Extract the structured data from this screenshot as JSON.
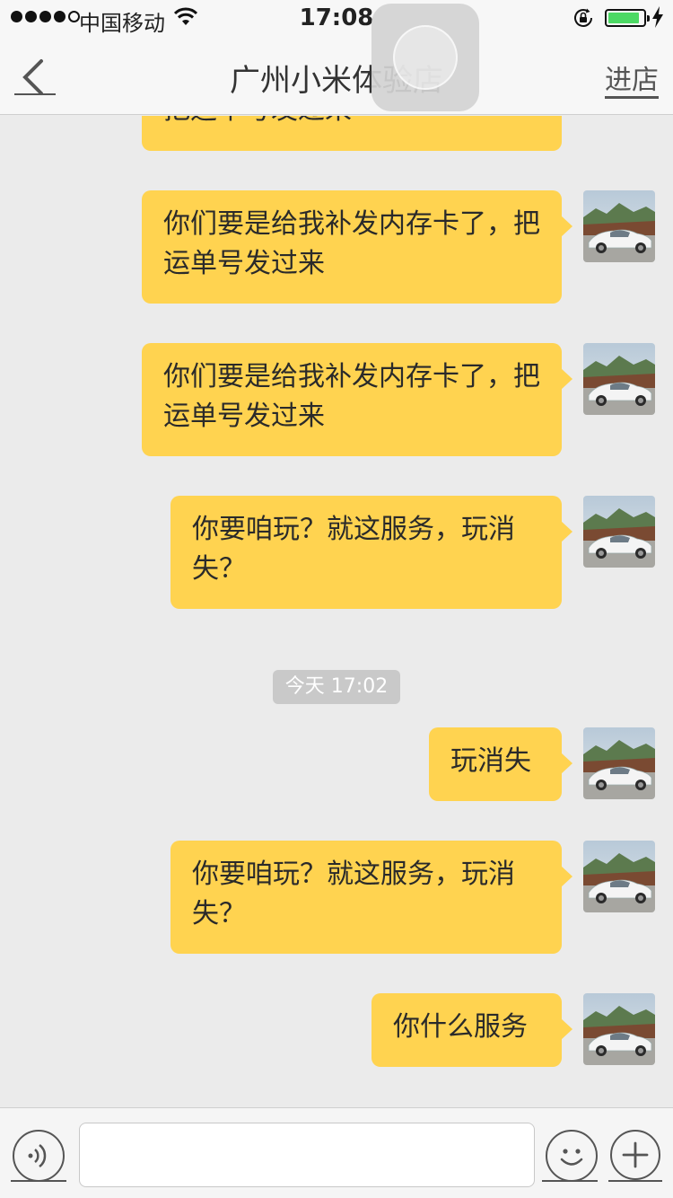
{
  "status_bar": {
    "carrier": "中国移动",
    "time": "17:08",
    "battery_level": 0.9,
    "battery_color": "#4cd964",
    "icons": [
      "signal-dots-icon",
      "wifi-icon",
      "rotation-lock-icon",
      "battery-icon",
      "charging-bolt-icon"
    ]
  },
  "nav": {
    "title": "广州小米体验店",
    "right_action": "进店",
    "back_icon": "chevron-left-icon"
  },
  "chat": {
    "bubble_color": "#ffd350",
    "messages": [
      {
        "from": "me",
        "text": "把运单号发过来"
      },
      {
        "from": "me",
        "text": "你们要是给我补发内存卡了，把运单号发过来"
      },
      {
        "from": "me",
        "text": "你们要是给我补发内存卡了，把运单号发过来"
      },
      {
        "from": "me",
        "text": "你要咱玩？就这服务，玩消失？"
      },
      {
        "from": "me",
        "text": "玩消失"
      },
      {
        "from": "me",
        "text": "你要咱玩？就这服务，玩消失？"
      },
      {
        "from": "me",
        "text": "你什么服务"
      }
    ],
    "timestamp": "今天 17:02"
  },
  "input_bar": {
    "icons": [
      "voice-icon",
      "emoji-icon",
      "plus-icon"
    ]
  }
}
